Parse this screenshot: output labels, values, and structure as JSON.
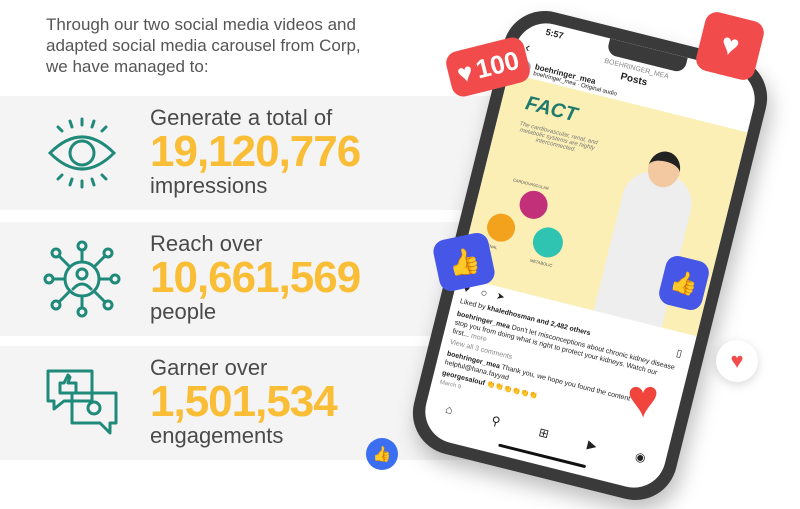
{
  "intro": "Through our two social media videos and adapted social media carousel from Corp, we have managed to:",
  "stats": [
    {
      "lead": "Generate a total of",
      "value": "19,120,776",
      "unit": "impressions",
      "icon": "eye-icon"
    },
    {
      "lead": "Reach over",
      "value": "10,661,569",
      "unit": "people",
      "icon": "network-person-icon"
    },
    {
      "lead": "Garner over",
      "value": "1,501,534",
      "unit": "engagements",
      "icon": "chat-thumbs-up-icon"
    }
  ],
  "colors": {
    "accent": "#f9bd36",
    "teal": "#1f8a7a",
    "band": "#f4f4f4"
  },
  "phone": {
    "time": "5:57",
    "account_caps": "BOEHRINGER_MEA",
    "header": "Posts",
    "username": "boehringer_mea",
    "audio": "boehringer_mea · Original audio",
    "post_title": "FACT",
    "post_text": "The cardiovascular, renal, and metabolic systems are highly interconnected.",
    "labels": {
      "cardio": "CARDIOVASCULAR",
      "renal": "RENAL",
      "metabolic": "METABOLIC"
    },
    "liked_by": "Liked by ",
    "liked_user": "khaledhosman",
    "liked_rest": " and 2,482 others",
    "caption_user": "boehringer_mea",
    "caption": " Don't let misconceptions about chronic kidney disease stop you from doing what is right to protect your kidneys. Watch our first...",
    "more": " more",
    "view_comments": "View all 3 comments",
    "comment1_user": "boehringer_mea",
    "comment1": " Thank you, we hope you found the content helpful@hana.fayyad",
    "comment2_user": "georgesalouf",
    "comment2": " 👏👏👏👏👏👏",
    "date": "March 9"
  },
  "badge_count": "100"
}
